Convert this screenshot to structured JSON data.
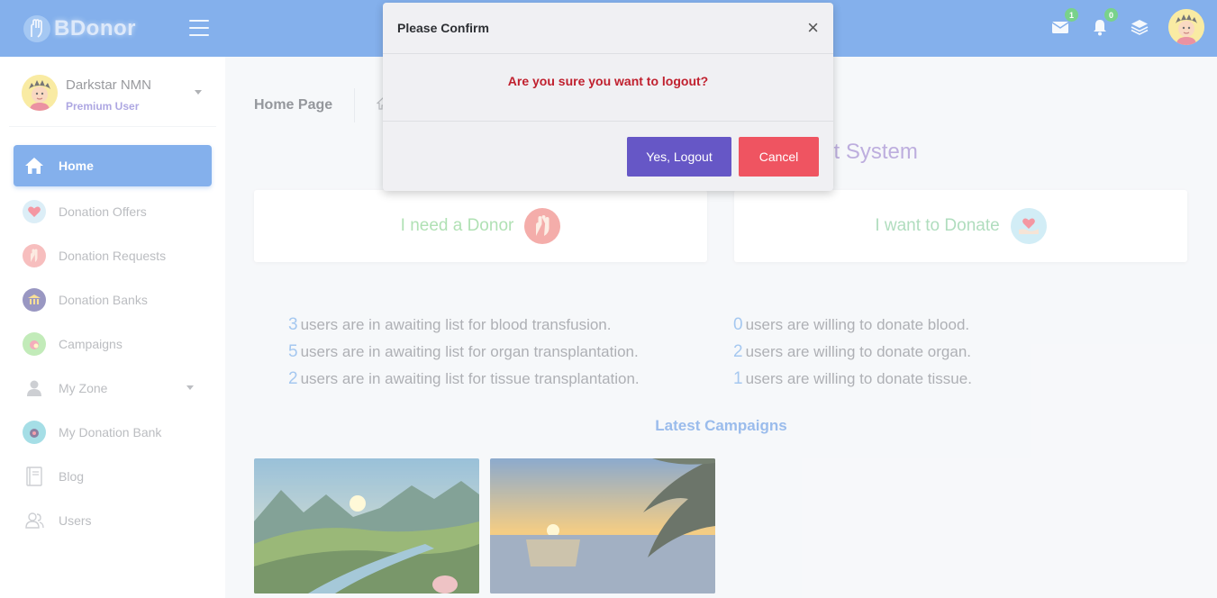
{
  "header": {
    "brand": "BDonor",
    "messages_badge": "1",
    "notifications_badge": "0"
  },
  "sidebar": {
    "user_name": "Darkstar NMN",
    "user_role": "Premium User",
    "items": [
      {
        "label": "Home",
        "icon": "home-icon"
      },
      {
        "label": "Donation Offers",
        "icon": "heart-hand-icon"
      },
      {
        "label": "Donation Requests",
        "icon": "hand-icon"
      },
      {
        "label": "Donation Banks",
        "icon": "bank-icon"
      },
      {
        "label": "Campaigns",
        "icon": "campaign-icon"
      },
      {
        "label": "My Zone",
        "icon": "user-icon"
      },
      {
        "label": "My Donation Bank",
        "icon": "bank-bag-icon"
      },
      {
        "label": "Blog",
        "icon": "notebook-icon"
      },
      {
        "label": "Users",
        "icon": "users-icon"
      }
    ]
  },
  "main": {
    "breadcrumb_title": "Home Page",
    "heading": "gement System",
    "card_need": "I need a Donor",
    "card_donate": "I want to Donate",
    "stats_left": [
      {
        "num": "3",
        "text": "users are in awaiting list for blood transfusion."
      },
      {
        "num": "5",
        "text": "users are in awaiting list for organ transplantation."
      },
      {
        "num": "2",
        "text": "users are in awaiting list for tissue transplantation."
      }
    ],
    "stats_right": [
      {
        "num": "0",
        "text": "users are willing to donate blood."
      },
      {
        "num": "2",
        "text": "users are willing to donate organ."
      },
      {
        "num": "1",
        "text": "users are willing to donate tissue."
      }
    ],
    "latest_title": "Latest Campaigns"
  },
  "modal": {
    "title": "Please Confirm",
    "close": "×",
    "message": "Are you sure you want to logout?",
    "yes_label": "Yes, Logout",
    "cancel_label": "Cancel"
  },
  "colors": {
    "primary": "#4f8fe4",
    "yes_button": "#6657c6",
    "cancel_button": "#ef5461",
    "warning_text": "#c0202e"
  }
}
